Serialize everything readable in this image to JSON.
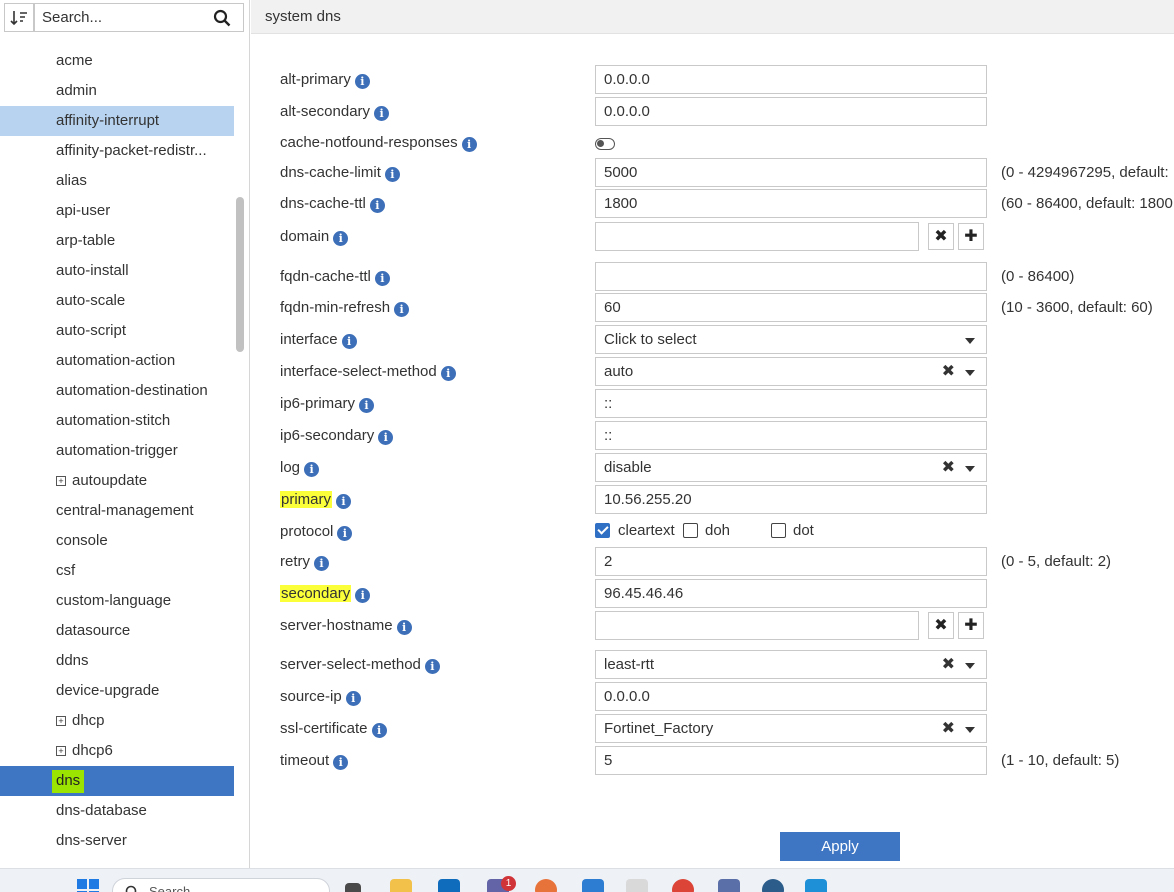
{
  "sidebar": {
    "search_placeholder": "Search...",
    "partial_item": "",
    "items": [
      {
        "label": "acme"
      },
      {
        "label": "admin"
      },
      {
        "label": "affinity-interrupt"
      },
      {
        "label": "affinity-packet-redistr..."
      },
      {
        "label": "alias"
      },
      {
        "label": "api-user"
      },
      {
        "label": "arp-table"
      },
      {
        "label": "auto-install"
      },
      {
        "label": "auto-scale"
      },
      {
        "label": "auto-script"
      },
      {
        "label": "automation-action"
      },
      {
        "label": "automation-destination"
      },
      {
        "label": "automation-stitch"
      },
      {
        "label": "automation-trigger"
      },
      {
        "label": "autoupdate"
      },
      {
        "label": "central-management"
      },
      {
        "label": "console"
      },
      {
        "label": "csf"
      },
      {
        "label": "custom-language"
      },
      {
        "label": "datasource"
      },
      {
        "label": "ddns"
      },
      {
        "label": "device-upgrade"
      },
      {
        "label": "dhcp"
      },
      {
        "label": "dhcp6"
      },
      {
        "label": "dns"
      },
      {
        "label": "dns-database"
      },
      {
        "label": "dns-server"
      }
    ],
    "expand_symbol": "+"
  },
  "header": {
    "title": "system dns"
  },
  "form": {
    "alt_primary": {
      "label": "alt-primary",
      "value": "0.0.0.0"
    },
    "alt_secondary": {
      "label": "alt-secondary",
      "value": "0.0.0.0"
    },
    "cache_notfound": {
      "label": "cache-notfound-responses",
      "enabled": false
    },
    "dns_cache_limit": {
      "label": "dns-cache-limit",
      "value": "5000",
      "hint": "(0 - 4294967295, default:"
    },
    "dns_cache_ttl": {
      "label": "dns-cache-ttl",
      "value": "1800",
      "hint": "(60 - 86400, default: 1800"
    },
    "domain": {
      "label": "domain",
      "value": ""
    },
    "fqdn_cache_ttl": {
      "label": "fqdn-cache-ttl",
      "value": "",
      "hint": "(0 - 86400)"
    },
    "fqdn_min_refresh": {
      "label": "fqdn-min-refresh",
      "value": "60",
      "hint": "(10 - 3600, default: 60)"
    },
    "interface": {
      "label": "interface",
      "value": "Click to select"
    },
    "interface_select_method": {
      "label": "interface-select-method",
      "value": "auto"
    },
    "ip6_primary": {
      "label": "ip6-primary",
      "value": "::"
    },
    "ip6_secondary": {
      "label": "ip6-secondary",
      "value": "::"
    },
    "log": {
      "label": "log",
      "value": "disable"
    },
    "primary": {
      "label": "primary",
      "value": "10.56.255.20"
    },
    "protocol": {
      "label": "protocol",
      "options": [
        {
          "label": "cleartext",
          "checked": true
        },
        {
          "label": "doh",
          "checked": false
        },
        {
          "label": "dot",
          "checked": false
        }
      ]
    },
    "retry": {
      "label": "retry",
      "value": "2",
      "hint": "(0 - 5, default: 2)"
    },
    "secondary": {
      "label": "secondary",
      "value": "96.45.46.46"
    },
    "server_hostname": {
      "label": "server-hostname",
      "value": ""
    },
    "server_select_method": {
      "label": "server-select-method",
      "value": "least-rtt"
    },
    "source_ip": {
      "label": "source-ip",
      "value": "0.0.0.0"
    },
    "ssl_certificate": {
      "label": "ssl-certificate",
      "value": "Fortinet_Factory"
    },
    "timeout": {
      "label": "timeout",
      "value": "5",
      "hint": "(1 - 10, default: 5)"
    }
  },
  "icons": {
    "info": "i",
    "clear": "✖",
    "add": "✚"
  },
  "apply_label": "Apply",
  "taskbar": {
    "search_placeholder": "Search",
    "notification_count": "1",
    "colors": {
      "windows": "#1f7be3",
      "edge": "#1e90d8",
      "chrome": "#db4437"
    }
  },
  "colors": {
    "accent": "#3f76c4",
    "selected_row": "#b8d3ef",
    "highlight_yellow": "#fbff3a",
    "highlight_green": "#9be300"
  }
}
